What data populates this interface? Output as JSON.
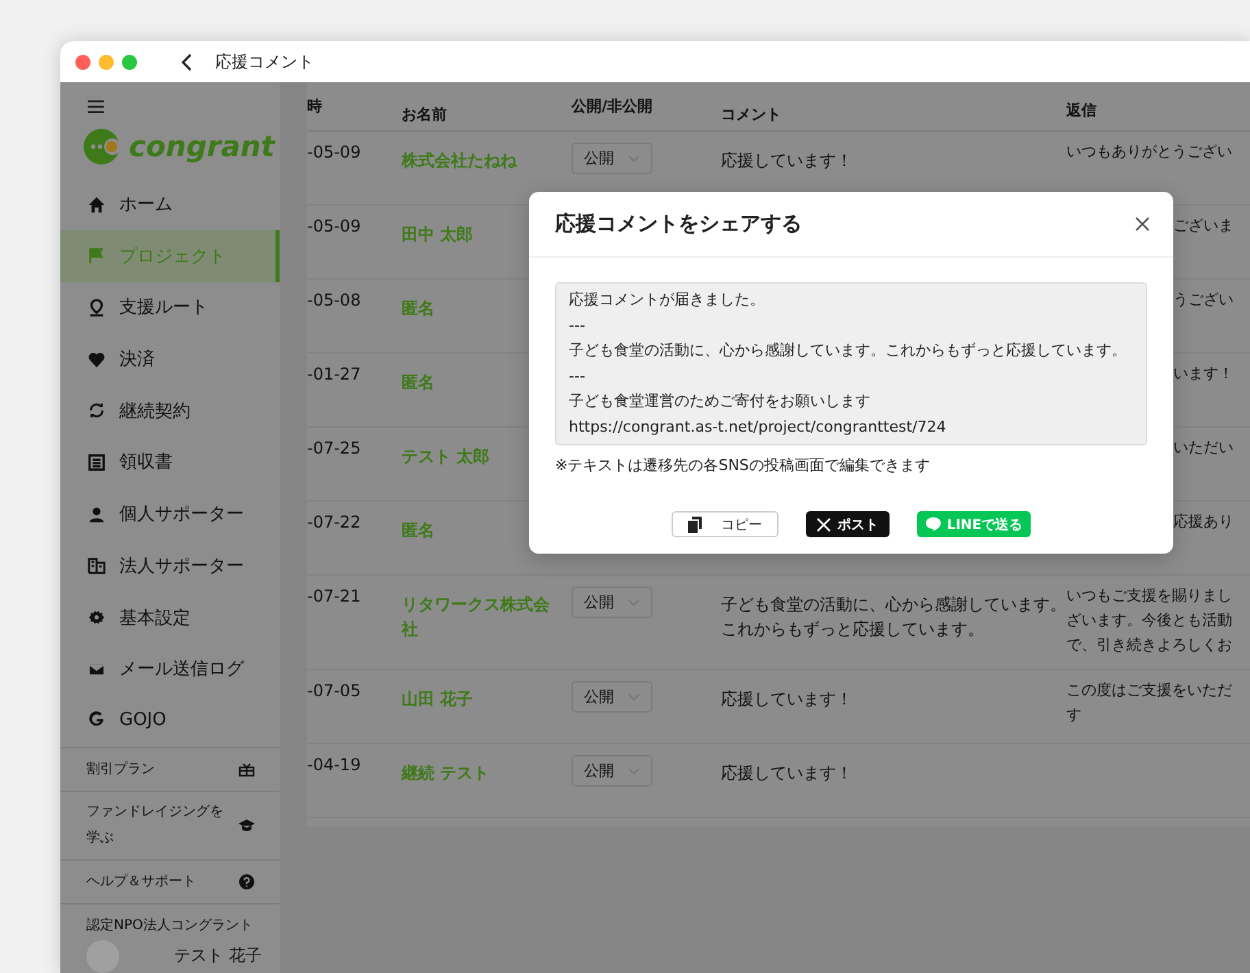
{
  "window": {
    "title": "応援コメント"
  },
  "sidebar": {
    "logo": "congrant",
    "items": [
      {
        "label": "ホーム",
        "selected": false
      },
      {
        "label": "プロジェクト",
        "selected": true
      },
      {
        "label": "支援ルート",
        "selected": false
      },
      {
        "label": "決済",
        "selected": false
      },
      {
        "label": "継続契約",
        "selected": false
      },
      {
        "label": "領収書",
        "selected": false
      },
      {
        "label": "個人サポーター",
        "selected": false
      },
      {
        "label": "法人サポーター",
        "selected": false
      },
      {
        "label": "基本設定",
        "selected": false
      },
      {
        "label": "メール送信ログ",
        "selected": false
      },
      {
        "label": "GOJO",
        "selected": false
      }
    ],
    "footer_items": [
      {
        "label": "割引プラン"
      },
      {
        "label": "ファンドレイジングを学ぶ"
      },
      {
        "label": "ヘルプ＆サポート"
      }
    ],
    "organization": "認定NPO法人コングラント",
    "user": "テスト 花子"
  },
  "table": {
    "columns": [
      "時",
      "お名前",
      "公開/非公開",
      "コメント",
      "返信"
    ],
    "rows": [
      {
        "date": "-05-09",
        "name": "株式会社たねね",
        "visibility": "公開",
        "comment": "応援しています！",
        "reply": [
          "いつもありがとうござい"
        ]
      },
      {
        "date": "-05-09",
        "name": "田中 太郎",
        "reply": [
          "ございま"
        ]
      },
      {
        "date": "-05-08",
        "name": "匿名",
        "reply": [
          "うござい"
        ]
      },
      {
        "date": "-01-27",
        "name": "匿名",
        "reply": [
          "います！"
        ]
      },
      {
        "date": "-07-25",
        "name": "テスト 太郎",
        "reply": [
          "いただい"
        ]
      },
      {
        "date": "-07-22",
        "name": "匿名",
        "reply": [
          "応援あり"
        ]
      },
      {
        "date": "-07-21",
        "name": "リタワークス株式会社",
        "visibility": "公開",
        "comment": "子ども食堂の活動に、心から感謝しています。これからもずっと応援しています。",
        "reply": [
          "いつもご支援を賜りまし",
          "ざいます。今後とも活動",
          "で、引き続きよろしくお"
        ]
      },
      {
        "date": "-07-05",
        "name": "山田 花子",
        "visibility": "公開",
        "comment": "応援しています！",
        "reply": [
          "この度はご支援をいただ",
          "す"
        ]
      },
      {
        "date": "-04-19",
        "name": "継続 テスト",
        "visibility": "公開",
        "comment": "応援しています！",
        "reply": []
      }
    ]
  },
  "modal": {
    "title": "応援コメントをシェアする",
    "message": "応援コメントが届きました。\n---\n子ども食堂の活動に、心から感謝しています。これからもずっと応援しています。\n---\n子ども食堂運営のためご寄付をお願いします\nhttps://congrant.as-t.net/project/congranttest/724",
    "note": "※テキストは遷移先の各SNSの投稿画面で編集できます",
    "buttons": [
      {
        "kind": "copy",
        "label": "コピー"
      },
      {
        "kind": "x",
        "label": "ポスト"
      },
      {
        "kind": "line",
        "label": "LINEで送る"
      }
    ]
  }
}
